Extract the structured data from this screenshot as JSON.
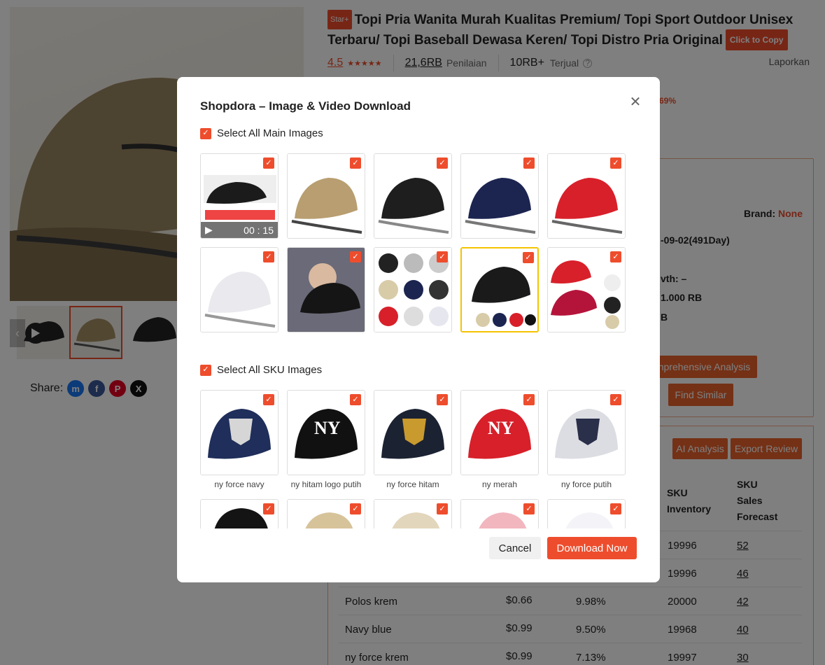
{
  "product": {
    "tag": "Star+",
    "title": "Topi Pria Wanita Murah Kualitas Premium/ Topi Sport Outdoor Unisex Terbaru/ Topi Baseball Dewasa Keren/ Topi Distro Pria Original",
    "copy_label": "Click to Copy",
    "rating": "4.5",
    "reviews_count": "21,6RB",
    "reviews_label": "Penilaian",
    "sold_count": "10RB+",
    "sold_label": "Terjual",
    "report_label": "Laporkan",
    "discount": "-69%"
  },
  "share": {
    "label": "Share:",
    "icons": [
      "messenger-icon",
      "facebook-icon",
      "pinterest-icon",
      "x-icon"
    ]
  },
  "panel": {
    "brand_label": "Brand:",
    "brand_value": "None",
    "date_value": "-09-02(491Day)",
    "growth_label": "vth: –",
    "rb_value_1": "1.000 RB",
    "rb_value_2": "B",
    "analysis_button": "nprehensive Analysis",
    "similar_button": "Find Similar",
    "ai_button": "AI Analysis",
    "export_button": "Export Review"
  },
  "table": {
    "headers": {
      "inventory": "SKU Inventory",
      "forecast": "SKU Sales Forecast"
    },
    "rows": [
      {
        "name": "",
        "price": "",
        "rate": "",
        "inventory": "19996",
        "forecast": "52"
      },
      {
        "name": "",
        "price": "",
        "rate": "",
        "inventory": "19996",
        "forecast": "46"
      },
      {
        "name": "Polos krem",
        "price": "$0.66",
        "rate": "9.98%",
        "inventory": "20000",
        "forecast": "42"
      },
      {
        "name": "Navy blue",
        "price": "$0.99",
        "rate": "9.50%",
        "inventory": "19968",
        "forecast": "40"
      },
      {
        "name": "ny force krem",
        "price": "$0.99",
        "rate": "7.13%",
        "inventory": "19997",
        "forecast": "30"
      }
    ]
  },
  "modal": {
    "title": "Shopdora – Image & Video Download",
    "select_main_label": "Select All Main Images",
    "select_sku_label": "Select All SKU Images",
    "video_duration": "00 : 15",
    "sku_captions": [
      "ny force navy",
      "ny hitam logo putih",
      "ny force hitam",
      "ny merah",
      "ny force putih"
    ],
    "cancel_label": "Cancel",
    "download_label": "Download Now"
  },
  "colors": {
    "accent": "#ee4d2d",
    "overlay": "rgba(0,0,0,0.5)"
  }
}
